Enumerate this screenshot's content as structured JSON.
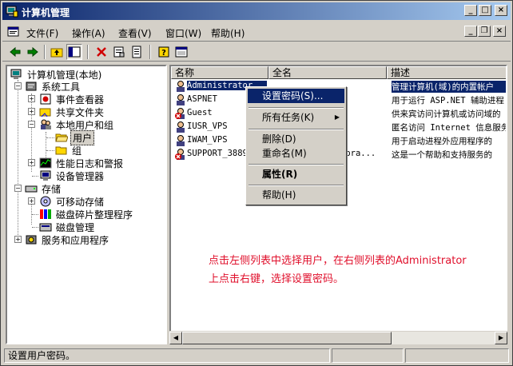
{
  "window": {
    "title": "计算机管理",
    "controls": {
      "minimize": "_",
      "maximize": "□",
      "close": "×"
    }
  },
  "menubar": {
    "items": [
      {
        "label": "文件(F)"
      },
      {
        "label": "操作(A)"
      },
      {
        "label": "查看(V)"
      },
      {
        "label": "窗口(W)"
      },
      {
        "label": "帮助(H)"
      }
    ],
    "mdi_controls": {
      "minimize": "_",
      "restore": "❐",
      "close": "×"
    }
  },
  "toolbar": {
    "icons": [
      "back-icon",
      "forward-icon",
      "up-folder-icon",
      "show-tree-icon",
      "delete-icon",
      "properties-icon",
      "export-list-icon",
      "help-icon",
      "console-icon"
    ]
  },
  "tree": {
    "nodes": [
      {
        "label": "计算机管理(本地)",
        "icon": "computer-management-icon"
      },
      {
        "label": "系统工具",
        "icon": "system-tools-icon"
      },
      {
        "label": "事件查看器",
        "icon": "event-viewer-icon"
      },
      {
        "label": "共享文件夹",
        "icon": "shared-folder-icon"
      },
      {
        "label": "本地用户和组",
        "icon": "local-users-icon"
      },
      {
        "label": "用户",
        "icon": "folder-icon"
      },
      {
        "label": "组",
        "icon": "folder-icon"
      },
      {
        "label": "性能日志和警报",
        "icon": "performance-icon"
      },
      {
        "label": "设备管理器",
        "icon": "device-manager-icon"
      },
      {
        "label": "存储",
        "icon": "storage-icon"
      },
      {
        "label": "可移动存储",
        "icon": "removable-storage-icon"
      },
      {
        "label": "磁盘碎片整理程序",
        "icon": "defrag-icon"
      },
      {
        "label": "磁盘管理",
        "icon": "disk-management-icon"
      },
      {
        "label": "服务和应用程序",
        "icon": "services-icon"
      }
    ]
  },
  "list": {
    "columns": [
      {
        "label": "名称"
      },
      {
        "label": "全名"
      },
      {
        "label": "描述"
      }
    ],
    "rows": [
      {
        "name": "Administrator",
        "full": "",
        "desc": "管理计算机(域)的内置帐户"
      },
      {
        "name": "ASPNET",
        "full": "户",
        "desc": "用于运行 ASP.NET 辅助进程"
      },
      {
        "name": "Guest",
        "full": "",
        "desc": "供来宾访问计算机或访问域的"
      },
      {
        "name": "IUSR_VPS",
        "full": "户",
        "desc": "匿名访问 Internet 信息服务"
      },
      {
        "name": "IWAM_VPS",
        "full": "户",
        "desc": "用于启动进程外应用程序的"
      },
      {
        "name": "SUPPORT_3889",
        "full": "pora...",
        "desc": "这是一个帮助和支持服务的"
      }
    ]
  },
  "context_menu": {
    "items": [
      {
        "label": "设置密码(S)..."
      },
      {
        "label": "所有任务(K)",
        "arrow": "▶"
      },
      {
        "label": "删除(D)"
      },
      {
        "label": "重命名(M)"
      },
      {
        "label": "属性(R)"
      },
      {
        "label": "帮助(H)"
      }
    ]
  },
  "annotation": {
    "line1": "点击左侧列表中选择用户，在右侧列表的Administrator",
    "line2": "上点击右键，选择设置密码。"
  },
  "statusbar": {
    "text": "设置用户密码。"
  },
  "colors": {
    "selection": "#0a246a",
    "annotation": "#e0102c",
    "face": "#d4d0c8"
  }
}
